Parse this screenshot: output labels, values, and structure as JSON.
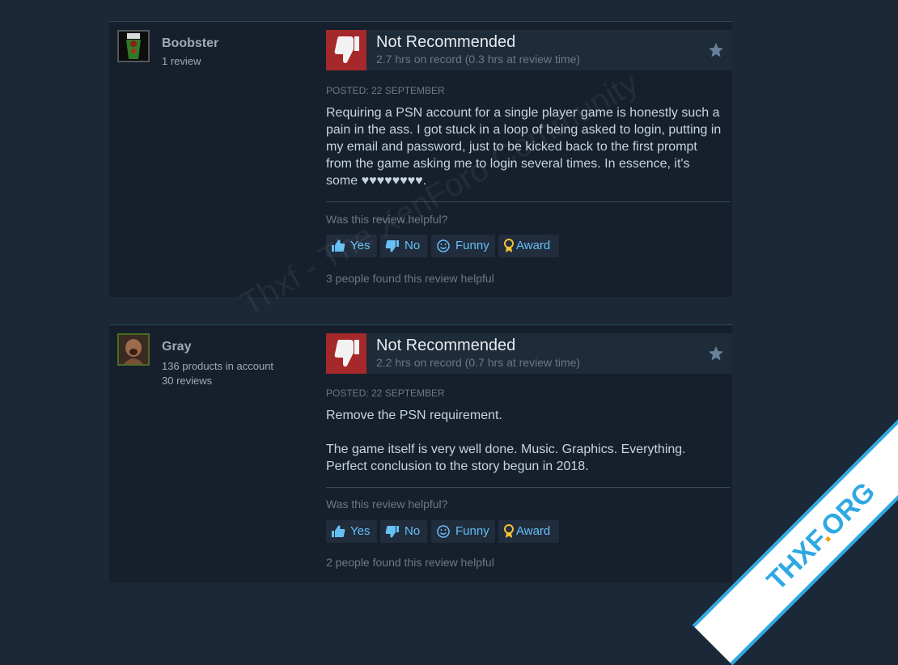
{
  "reviews": [
    {
      "author": {
        "name": "Boobster",
        "lines": [
          "1 review"
        ]
      },
      "verdict": "Not Recommended",
      "hours": "2.7 hrs on record (0.3 hrs at review time)",
      "posted": "Posted: 22 September",
      "paragraphs": [
        "Requiring a PSN account for a single player game is honestly such a pain in the ass. I got stuck in a loop of being asked to login, putting in my email and password, just to be kicked back to the first prompt from the game asking me to login several times. In essence, it's some ♥♥♥♥♥♥♥♥."
      ],
      "helpful_question": "Was this review helpful?",
      "buttons": {
        "yes": "Yes",
        "no": "No",
        "funny": "Funny",
        "award": "Award"
      },
      "found_helpful": "3 people found this review helpful"
    },
    {
      "author": {
        "name": "Gray",
        "lines": [
          "136 products in account",
          "30 reviews"
        ]
      },
      "verdict": "Not Recommended",
      "hours": "2.2 hrs on record (0.7 hrs at review time)",
      "posted": "Posted: 22 September",
      "paragraphs": [
        "Remove the PSN requirement.",
        "The game itself is very well done. Music. Graphics. Everything. Perfect conclusion to the story begun in 2018."
      ],
      "helpful_question": "Was this review helpful?",
      "buttons": {
        "yes": "Yes",
        "no": "No",
        "funny": "Funny",
        "award": "Award"
      },
      "found_helpful": "2 people found this review helpful"
    }
  ],
  "watermark": "Thxf - The XenForo Community",
  "corner_badge": {
    "main": "THXF",
    "dot": ".",
    "suffix": "ORG"
  },
  "colors": {
    "accent": "#66c0f4",
    "thumb_down_bg": "#a5282a",
    "card_bg": "#16202d",
    "page_bg": "#1b2838"
  },
  "icons": [
    "thumbs-down-icon",
    "star-icon",
    "thumbs-up-icon",
    "smiley-icon",
    "award-ribbon-icon"
  ]
}
